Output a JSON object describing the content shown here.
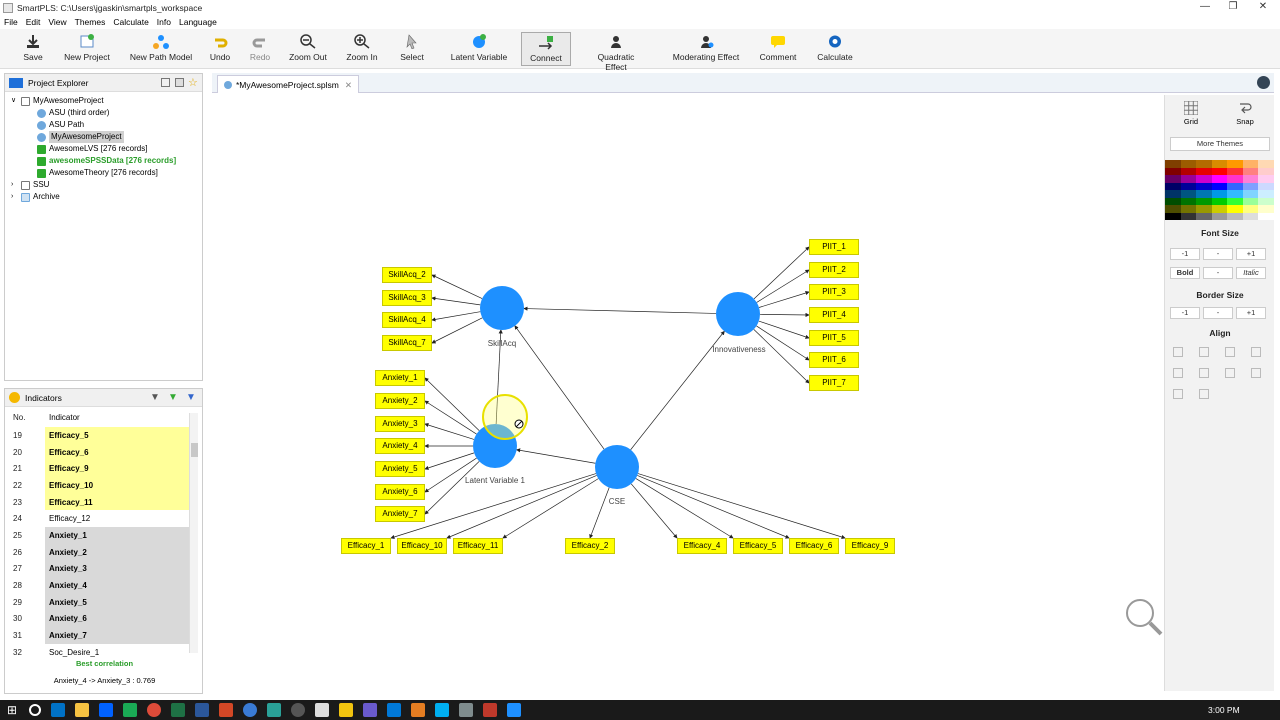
{
  "window": {
    "title": "SmartPLS: C:\\Users\\jgaskin\\smartpls_workspace",
    "min": "—",
    "max": "❐",
    "close": "✕"
  },
  "menu": [
    "File",
    "Edit",
    "View",
    "Themes",
    "Calculate",
    "Info",
    "Language"
  ],
  "toolbar": {
    "save": "Save",
    "new_project": "New Project",
    "new_path_model": "New Path Model",
    "undo": "Undo",
    "redo": "Redo",
    "zoom_out": "Zoom Out",
    "zoom_in": "Zoom In",
    "select": "Select",
    "latent_variable": "Latent Variable",
    "connect": "Connect",
    "quadratic_effect": "Quadratic Effect",
    "moderating_effect": "Moderating Effect",
    "comment": "Comment",
    "calculate": "Calculate"
  },
  "project_explorer": {
    "title": "Project Explorer",
    "items": [
      {
        "label": "MyAwesomeProject"
      },
      {
        "label": "ASU (third order)"
      },
      {
        "label": "ASU Path"
      },
      {
        "label": "MyAwesomeProject"
      },
      {
        "label": "AwesomeLVS [276 records]"
      },
      {
        "label": "awesomeSPSSData [276 records]"
      },
      {
        "label": "AwesomeTheory [276 records]"
      },
      {
        "label": "SSU"
      },
      {
        "label": "Archive"
      }
    ]
  },
  "indicators": {
    "title": "Indicators",
    "col_no": "No.",
    "col_indicator": "Indicator",
    "rows": [
      {
        "no": "19",
        "name": "Efficacy_5"
      },
      {
        "no": "20",
        "name": "Efficacy_6"
      },
      {
        "no": "21",
        "name": "Efficacy_9"
      },
      {
        "no": "22",
        "name": "Efficacy_10"
      },
      {
        "no": "23",
        "name": "Efficacy_11"
      },
      {
        "no": "24",
        "name": "Efficacy_12"
      },
      {
        "no": "25",
        "name": "Anxiety_1"
      },
      {
        "no": "26",
        "name": "Anxiety_2"
      },
      {
        "no": "27",
        "name": "Anxiety_3"
      },
      {
        "no": "28",
        "name": "Anxiety_4"
      },
      {
        "no": "29",
        "name": "Anxiety_5"
      },
      {
        "no": "30",
        "name": "Anxiety_6"
      },
      {
        "no": "31",
        "name": "Anxiety_7"
      },
      {
        "no": "32",
        "name": "Soc_Desire_1"
      }
    ],
    "best_corr_label": "Best correlation",
    "best_corr_value": "Anxiety_4 -> Anxiety_3 : 0.769"
  },
  "editor_tab": "*MyAwesomeProject.splsm",
  "model": {
    "latent": {
      "skillacq": "SkillAcq",
      "innovativeness": "Innovativeness",
      "latent1": "Latent Variable 1",
      "cse": "CSE"
    },
    "indicators": {
      "skillacq": [
        "SkillAcq_2",
        "SkillAcq_3",
        "SkillAcq_4",
        "SkillAcq_7"
      ],
      "piit": [
        "PIIT_1",
        "PIIT_2",
        "PIIT_3",
        "PIIT_4",
        "PIIT_5",
        "PIIT_6",
        "PIIT_7"
      ],
      "anxiety": [
        "Anxiety_1",
        "Anxiety_2",
        "Anxiety_3",
        "Anxiety_4",
        "Anxiety_5",
        "Anxiety_6",
        "Anxiety_7"
      ],
      "efficacy": [
        "Efficacy_1",
        "Efficacy_10",
        "Efficacy_11",
        "Efficacy_2",
        "Efficacy_4",
        "Efficacy_5",
        "Efficacy_6",
        "Efficacy_9"
      ]
    },
    "colors": {
      "latent": "#1e90ff",
      "indicator": "#ffff00",
      "indicator_border": "#c8c800"
    }
  },
  "right_panel": {
    "grid": "Grid",
    "snap": "Snap",
    "more_themes": "More Themes",
    "font_size": "Font Size",
    "minus": "-1",
    "dot": "-",
    "plus": "+1",
    "bold": "Bold",
    "italic": "Italic",
    "border_size": "Border Size",
    "align": "Align"
  },
  "taskbar": {
    "time": "3:00 PM"
  }
}
